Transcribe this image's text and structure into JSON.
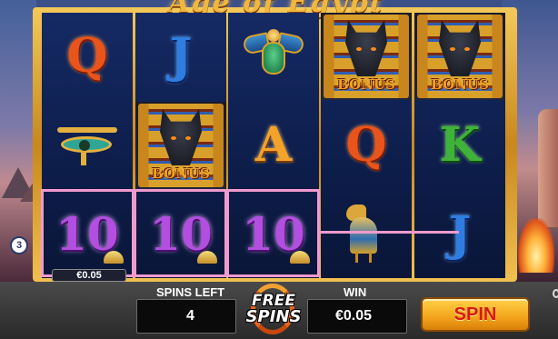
{
  "game": {
    "title": "Age of Egypt"
  },
  "reels": [
    {
      "symbols": [
        "Q",
        "eye-of-horus",
        "10"
      ]
    },
    {
      "symbols": [
        "J",
        "BONUS",
        "10"
      ]
    },
    {
      "symbols": [
        "scarab",
        "A",
        "10"
      ]
    },
    {
      "symbols": [
        "BONUS",
        "Q",
        "falcon"
      ]
    },
    {
      "symbols": [
        "BONUS",
        "K",
        "J"
      ]
    }
  ],
  "symbol_text": {
    "q": "Q",
    "j": "J",
    "a": "A",
    "k": "K",
    "ten": "10",
    "bonus": "BONUS"
  },
  "payline": {
    "number": "3",
    "win_amount": "€0.05"
  },
  "footer": {
    "spins_left_label": "SPINS LEFT",
    "spins_left_value": "4",
    "free_spins_line1": "FREE",
    "free_spins_line2": "SPINS",
    "win_label": "WIN",
    "win_value": "€0.05",
    "spin_button": "SPIN"
  },
  "colors": {
    "payline": "#f09acd",
    "spin_button": "#f3a31a",
    "spin_text": "#d61a10",
    "frame_gold": "#e0a83a"
  }
}
